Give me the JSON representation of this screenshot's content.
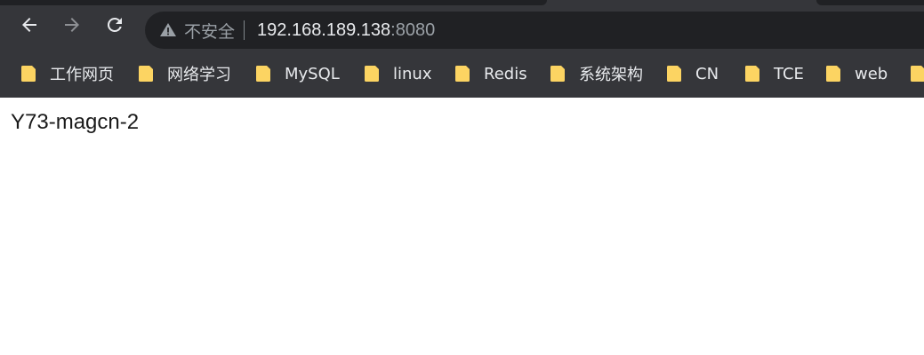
{
  "browser": {
    "address_bar": {
      "security_label": "不安全",
      "url_host": "192.168.189.138",
      "url_port": ":8080"
    },
    "bookmarks": [
      {
        "label": "工作网页",
        "icon": "folder-icon"
      },
      {
        "label": "网络学习",
        "icon": "folder-icon"
      },
      {
        "label": "MySQL",
        "icon": "folder-icon"
      },
      {
        "label": "linux",
        "icon": "folder-icon"
      },
      {
        "label": "Redis",
        "icon": "folder-icon"
      },
      {
        "label": "系统架构",
        "icon": "folder-icon"
      },
      {
        "label": "CN",
        "icon": "folder-icon"
      },
      {
        "label": "TCE",
        "icon": "folder-icon"
      },
      {
        "label": "web",
        "icon": "folder-icon"
      }
    ],
    "colors": {
      "toolbar": "#35363a",
      "omnibox": "#202124",
      "folder": "#fcd462"
    }
  },
  "page": {
    "text": "Y73-magcn-2"
  }
}
